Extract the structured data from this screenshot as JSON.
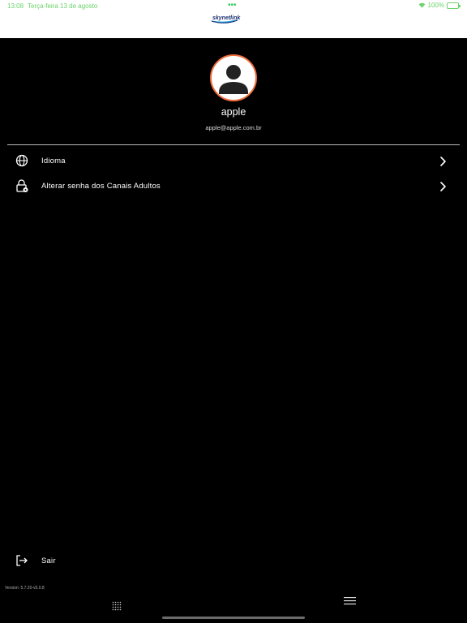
{
  "status_bar": {
    "time": "13:08",
    "date": "Terça-feira 13 de agosto",
    "battery": "100%",
    "dots": "•••"
  },
  "header": {
    "logo_text": "skynetlink"
  },
  "profile": {
    "name": "apple",
    "email": "apple@apple.com.br",
    "avatar_icon": "user-avatar-icon"
  },
  "menu": {
    "items": [
      {
        "label": "Idioma",
        "icon": "globe-icon"
      },
      {
        "label": "Alterar senha dos Canais Adultos",
        "icon": "lock-icon"
      }
    ]
  },
  "footer": {
    "logout_label": "Sair",
    "version": "Version: 5.7.20-v5.0.8"
  },
  "colors": {
    "background": "#000000",
    "avatar_border": "#ef6b3a",
    "status_green": "#6ad36a"
  }
}
